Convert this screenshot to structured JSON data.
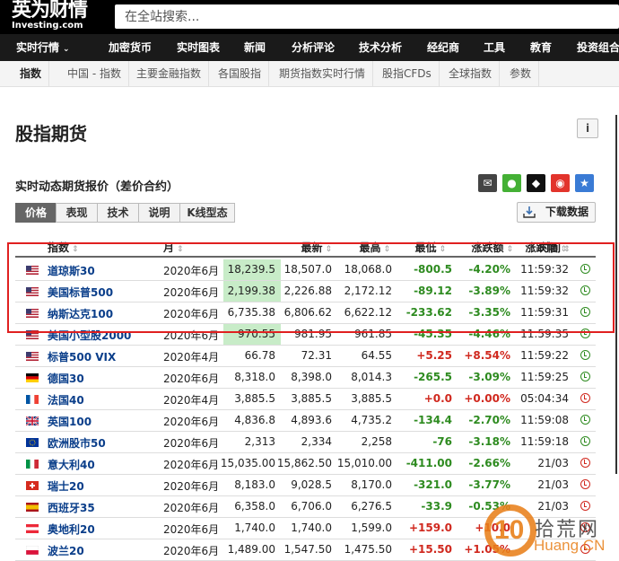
{
  "header": {
    "logo_cn": "英为财情",
    "logo_en": "Investing.com",
    "search_placeholder": "在全站搜索..."
  },
  "nav": [
    {
      "label": "实时行情",
      "caret": "⌄"
    },
    {
      "label": "加密货币"
    },
    {
      "label": "实时图表"
    },
    {
      "label": "新闻"
    },
    {
      "label": "分析评论"
    },
    {
      "label": "技术分析"
    },
    {
      "label": "经纪商"
    },
    {
      "label": "工具"
    },
    {
      "label": "教育"
    },
    {
      "label": "投资组合"
    }
  ],
  "subnav": [
    "指数",
    "中国 - 指数",
    "主要金融指数",
    "各国股指",
    "期货指数实时行情",
    "股指CFDs",
    "全球指数",
    "参数"
  ],
  "page": {
    "title": "股指期货",
    "info_label": "i",
    "section_title": "实时动态期货报价（差价合约）",
    "download_label": "下载数据"
  },
  "share": [
    {
      "icon": "email-icon",
      "color": "#444444"
    },
    {
      "icon": "wechat-icon",
      "color": "#44b035"
    },
    {
      "icon": "qq-icon",
      "color": "#111111"
    },
    {
      "icon": "weibo-icon",
      "color": "#e2342c"
    },
    {
      "icon": "favorite-star-icon",
      "color": "#3a7bd5"
    }
  ],
  "tabs": [
    "价格",
    "表现",
    "技术",
    "说明",
    "K线型态"
  ],
  "table": {
    "columns": [
      "指数",
      "月",
      "最新",
      "最高",
      "最低",
      "涨跌额",
      "涨跌幅",
      "时间"
    ],
    "rows": [
      {
        "flag": "us",
        "name": "道琼斯30",
        "month": "2020年6月",
        "last": "18,239.5",
        "high": "18,507.0",
        "low": "18,068.0",
        "chg": "-800.5",
        "pct": "-4.20%",
        "time": "11:59:32",
        "dir": "down",
        "hl": true
      },
      {
        "flag": "us",
        "name": "美国标普500",
        "month": "2020年6月",
        "last": "2,199.38",
        "high": "2,226.88",
        "low": "2,172.12",
        "chg": "-89.12",
        "pct": "-3.89%",
        "time": "11:59:32",
        "dir": "down",
        "hl": true
      },
      {
        "flag": "us",
        "name": "纳斯达克100",
        "month": "2020年6月",
        "last": "6,735.38",
        "high": "6,806.62",
        "low": "6,622.12",
        "chg": "-233.62",
        "pct": "-3.35%",
        "time": "11:59:31",
        "dir": "down",
        "hl": false
      },
      {
        "flag": "us",
        "name": "美国小型股2000",
        "month": "2020年6月",
        "last": "970.55",
        "high": "981.95",
        "low": "961.85",
        "chg": "-45.35",
        "pct": "-4.46%",
        "time": "11:59:35",
        "dir": "down",
        "hl": true
      },
      {
        "flag": "us",
        "name": "标普500 VIX",
        "month": "2020年4月",
        "last": "66.78",
        "high": "72.31",
        "low": "64.55",
        "chg": "+5.25",
        "pct": "+8.54%",
        "time": "11:59:22",
        "dir": "up",
        "hl": false
      },
      {
        "flag": "de",
        "name": "德国30",
        "month": "2020年6月",
        "last": "8,318.0",
        "high": "8,398.0",
        "low": "8,014.3",
        "chg": "-265.5",
        "pct": "-3.09%",
        "time": "11:59:25",
        "dir": "down",
        "hl": false
      },
      {
        "flag": "fr",
        "name": "法国40",
        "month": "2020年4月",
        "last": "3,885.5",
        "high": "3,885.5",
        "low": "3,885.5",
        "chg": "+0.0",
        "pct": "+0.00%",
        "time": "05:04:34",
        "dir": "up",
        "hl": false
      },
      {
        "flag": "uk",
        "name": "英国100",
        "month": "2020年6月",
        "last": "4,836.8",
        "high": "4,893.6",
        "low": "4,735.2",
        "chg": "-134.4",
        "pct": "-2.70%",
        "time": "11:59:08",
        "dir": "down",
        "hl": false
      },
      {
        "flag": "eu",
        "name": "欧洲股市50",
        "month": "2020年6月",
        "last": "2,313",
        "high": "2,334",
        "low": "2,258",
        "chg": "-76",
        "pct": "-3.18%",
        "time": "11:59:18",
        "dir": "down",
        "hl": false
      },
      {
        "flag": "it",
        "name": "意大利40",
        "month": "2020年6月",
        "last": "15,035.00",
        "high": "15,862.50",
        "low": "15,010.00",
        "chg": "-411.00",
        "pct": "-2.66%",
        "time": "21/03",
        "dir": "down",
        "hl": false
      },
      {
        "flag": "ch",
        "name": "瑞士20",
        "month": "2020年6月",
        "last": "8,183.0",
        "high": "9,028.5",
        "low": "8,170.0",
        "chg": "-321.0",
        "pct": "-3.77%",
        "time": "21/03",
        "dir": "down",
        "hl": false
      },
      {
        "flag": "es",
        "name": "西班牙35",
        "month": "2020年6月",
        "last": "6,358.0",
        "high": "6,706.0",
        "low": "6,276.5",
        "chg": "-33.9",
        "pct": "-0.53%",
        "time": "21/03",
        "dir": "down",
        "hl": false
      },
      {
        "flag": "at",
        "name": "奥地利20",
        "month": "2020年6月",
        "last": "1,740.0",
        "high": "1,740.0",
        "low": "1,599.0",
        "chg": "+159.0",
        "pct": "+10.0",
        "time": "",
        "dir": "up",
        "hl": false
      },
      {
        "flag": "pl",
        "name": "波兰20",
        "month": "2020年6月",
        "last": "1,489.00",
        "high": "1,547.50",
        "low": "1,475.50",
        "chg": "+15.50",
        "pct": "+1.05%",
        "time": "",
        "dir": "up",
        "hl": false
      }
    ]
  },
  "watermark": {
    "number": "10",
    "cn": "拾荒网",
    "en": "Huang.CN"
  }
}
